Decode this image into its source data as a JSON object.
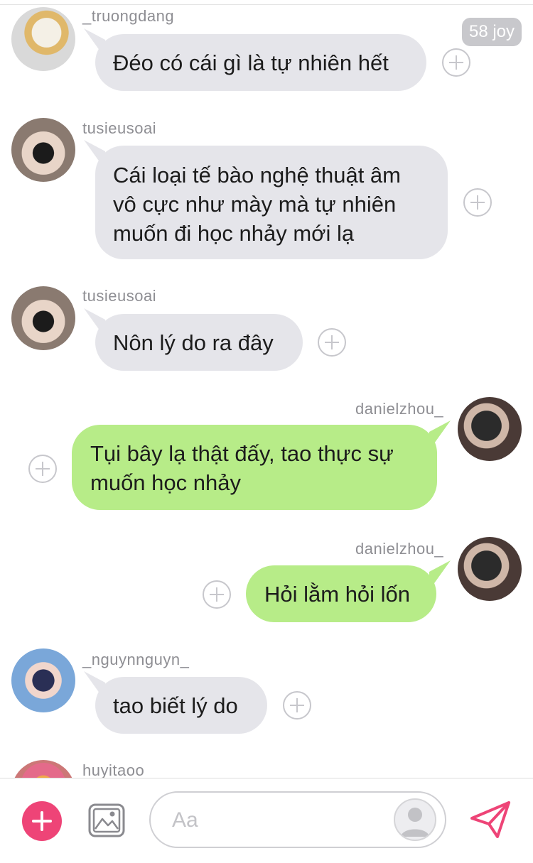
{
  "top_badge": {
    "label": "58 joy"
  },
  "messages": [
    {
      "user": "_truongdang",
      "text": "Đéo có cái gì là tự nhiên hết",
      "side": "left"
    },
    {
      "user": "tusieusoai",
      "lines": [
        "Cái loại tế bào nghệ thuật âm",
        "vô cực như mày mà tự nhiên",
        "muốn đi học nhảy mới lạ"
      ],
      "side": "left"
    },
    {
      "user": "tusieusoai",
      "text": "Nôn lý do ra đây",
      "side": "left"
    },
    {
      "user": "danielzhou_",
      "lines": [
        "Tụi bây lạ thật đấy, tao thực sự",
        "muốn học nhảy"
      ],
      "side": "right"
    },
    {
      "user": "danielzhou_",
      "text": "Hỏi lằm hỏi lốn",
      "side": "right"
    },
    {
      "user": "_nguynnguyn_",
      "text": "tao biết lý do",
      "side": "left"
    },
    {
      "user": "huyitaoo",
      "side": "left"
    }
  ],
  "composer": {
    "placeholder": "Aa",
    "add_icon": "plus-icon",
    "image_icon": "image-icon",
    "profile_icon": "person-icon",
    "send_icon": "send-icon"
  },
  "colors": {
    "bubble_gray": "#e5e5ea",
    "bubble_green": "#b7ec88",
    "accent": "#ee4477"
  }
}
